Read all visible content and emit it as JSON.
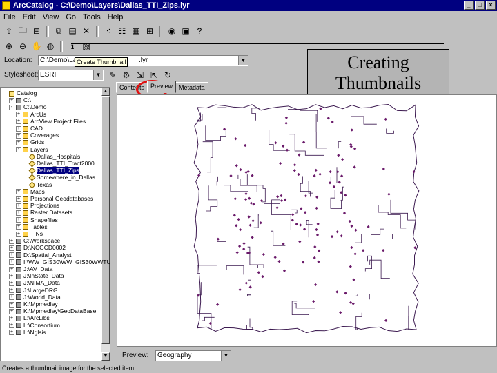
{
  "window": {
    "title": "ArcCatalog - C:\\Demo\\Layers\\Dallas_TTI_Zips.lyr"
  },
  "menu": [
    "File",
    "Edit",
    "View",
    "Go",
    "Tools",
    "Help"
  ],
  "toolbar": {
    "location_label": "Location:",
    "location_value": "C:\\Demo\\Layers",
    "location_suffix": ".lyr",
    "tooltip": "Create Thumbnail",
    "stylesheet_label": "Stylesheet:",
    "stylesheet_value": "ESRI"
  },
  "overlay": {
    "line1": "Creating",
    "line2": "Thumbnails"
  },
  "tree": {
    "items": [
      {
        "label": "Catalog",
        "indent": 0,
        "icon": "catalog-icon",
        "expander": ""
      },
      {
        "label": "C:\\",
        "indent": 1,
        "icon": "drive-icon",
        "expander": "+"
      },
      {
        "label": "C:\\Demo",
        "indent": 1,
        "icon": "drive-icon",
        "expander": "-"
      },
      {
        "label": "ArcUs",
        "indent": 2,
        "icon": "folder-icon",
        "expander": "+"
      },
      {
        "label": "ArcView Project Files",
        "indent": 2,
        "icon": "folder-icon",
        "expander": "+"
      },
      {
        "label": "CAD",
        "indent": 2,
        "icon": "folder-icon",
        "expander": "+"
      },
      {
        "label": "Coverages",
        "indent": 2,
        "icon": "folder-icon",
        "expander": "+"
      },
      {
        "label": "Grids",
        "indent": 2,
        "icon": "folder-icon",
        "expander": "+"
      },
      {
        "label": "Layers",
        "indent": 2,
        "icon": "folder-icon",
        "expander": "-"
      },
      {
        "label": "Dallas_Hospitals",
        "indent": 3,
        "icon": "layer-icon",
        "expander": ""
      },
      {
        "label": "Dallas_TTI_Tract2000",
        "indent": 3,
        "icon": "layer-icon",
        "expander": ""
      },
      {
        "label": "Dallas_TTI_Zips",
        "indent": 3,
        "icon": "layer-icon",
        "expander": "",
        "selected": true
      },
      {
        "label": "Somewhere_in_Dallas",
        "indent": 3,
        "icon": "layer-icon",
        "expander": ""
      },
      {
        "label": "Texas",
        "indent": 3,
        "icon": "layer-icon",
        "expander": ""
      },
      {
        "label": "Maps",
        "indent": 2,
        "icon": "folder-icon",
        "expander": "+"
      },
      {
        "label": "Personal Geodatabases",
        "indent": 2,
        "icon": "folder-icon",
        "expander": "+"
      },
      {
        "label": "Projections",
        "indent": 2,
        "icon": "folder-icon",
        "expander": "+"
      },
      {
        "label": "Raster Datasets",
        "indent": 2,
        "icon": "folder-icon",
        "expander": "+"
      },
      {
        "label": "Shapefiles",
        "indent": 2,
        "icon": "folder-icon",
        "expander": "+"
      },
      {
        "label": "Tables",
        "indent": 2,
        "icon": "folder-icon",
        "expander": "+"
      },
      {
        "label": "TINs",
        "indent": 2,
        "icon": "folder-icon",
        "expander": "+"
      },
      {
        "label": "C:\\Workspace",
        "indent": 1,
        "icon": "drive-icon",
        "expander": "+"
      },
      {
        "label": "D:\\NCGCD0002",
        "indent": 1,
        "icon": "drive-icon",
        "expander": "+"
      },
      {
        "label": "D:\\Spatial_Analyst",
        "indent": 1,
        "icon": "drive-icon",
        "expander": "+"
      },
      {
        "label": "I:\\WW_GIS30\\WW_GIS30WWTUTO",
        "indent": 1,
        "icon": "drive-icon",
        "expander": "+"
      },
      {
        "label": "J:\\AV_Data",
        "indent": 1,
        "icon": "drive-icon",
        "expander": "+"
      },
      {
        "label": "J:\\InState_Data",
        "indent": 1,
        "icon": "drive-icon",
        "expander": "+"
      },
      {
        "label": "J:\\NIMA_Data",
        "indent": 1,
        "icon": "drive-icon",
        "expander": "+"
      },
      {
        "label": "J:\\LargeDRG",
        "indent": 1,
        "icon": "drive-icon",
        "expander": "+"
      },
      {
        "label": "J:\\World_Data",
        "indent": 1,
        "icon": "drive-icon",
        "expander": "+"
      },
      {
        "label": "K:\\Mpmedley",
        "indent": 1,
        "icon": "drive-icon",
        "expander": "+"
      },
      {
        "label": "K:\\Mpmedley\\GeoDataBase",
        "indent": 1,
        "icon": "drive-icon",
        "expander": "+"
      },
      {
        "label": "L:\\ArcLibs",
        "indent": 1,
        "icon": "drive-icon",
        "expander": "+"
      },
      {
        "label": "L:\\Consortium",
        "indent": 1,
        "icon": "drive-icon",
        "expander": "+"
      },
      {
        "label": "L:\\Nglsis",
        "indent": 1,
        "icon": "drive-icon",
        "expander": "+"
      }
    ]
  },
  "tabs": [
    {
      "label": "Contents",
      "active": false
    },
    {
      "label": "Preview",
      "active": true
    },
    {
      "label": "Metadata",
      "active": false
    }
  ],
  "preview": {
    "label": "Preview:",
    "mode": "Geography"
  },
  "status": {
    "text": "Creates a thumbnail image for the selected item"
  },
  "colors": {
    "title_bar": "#000080",
    "map_lines": "#3c1a50",
    "points": "#6a1a6a",
    "highlight": "#e01010"
  }
}
